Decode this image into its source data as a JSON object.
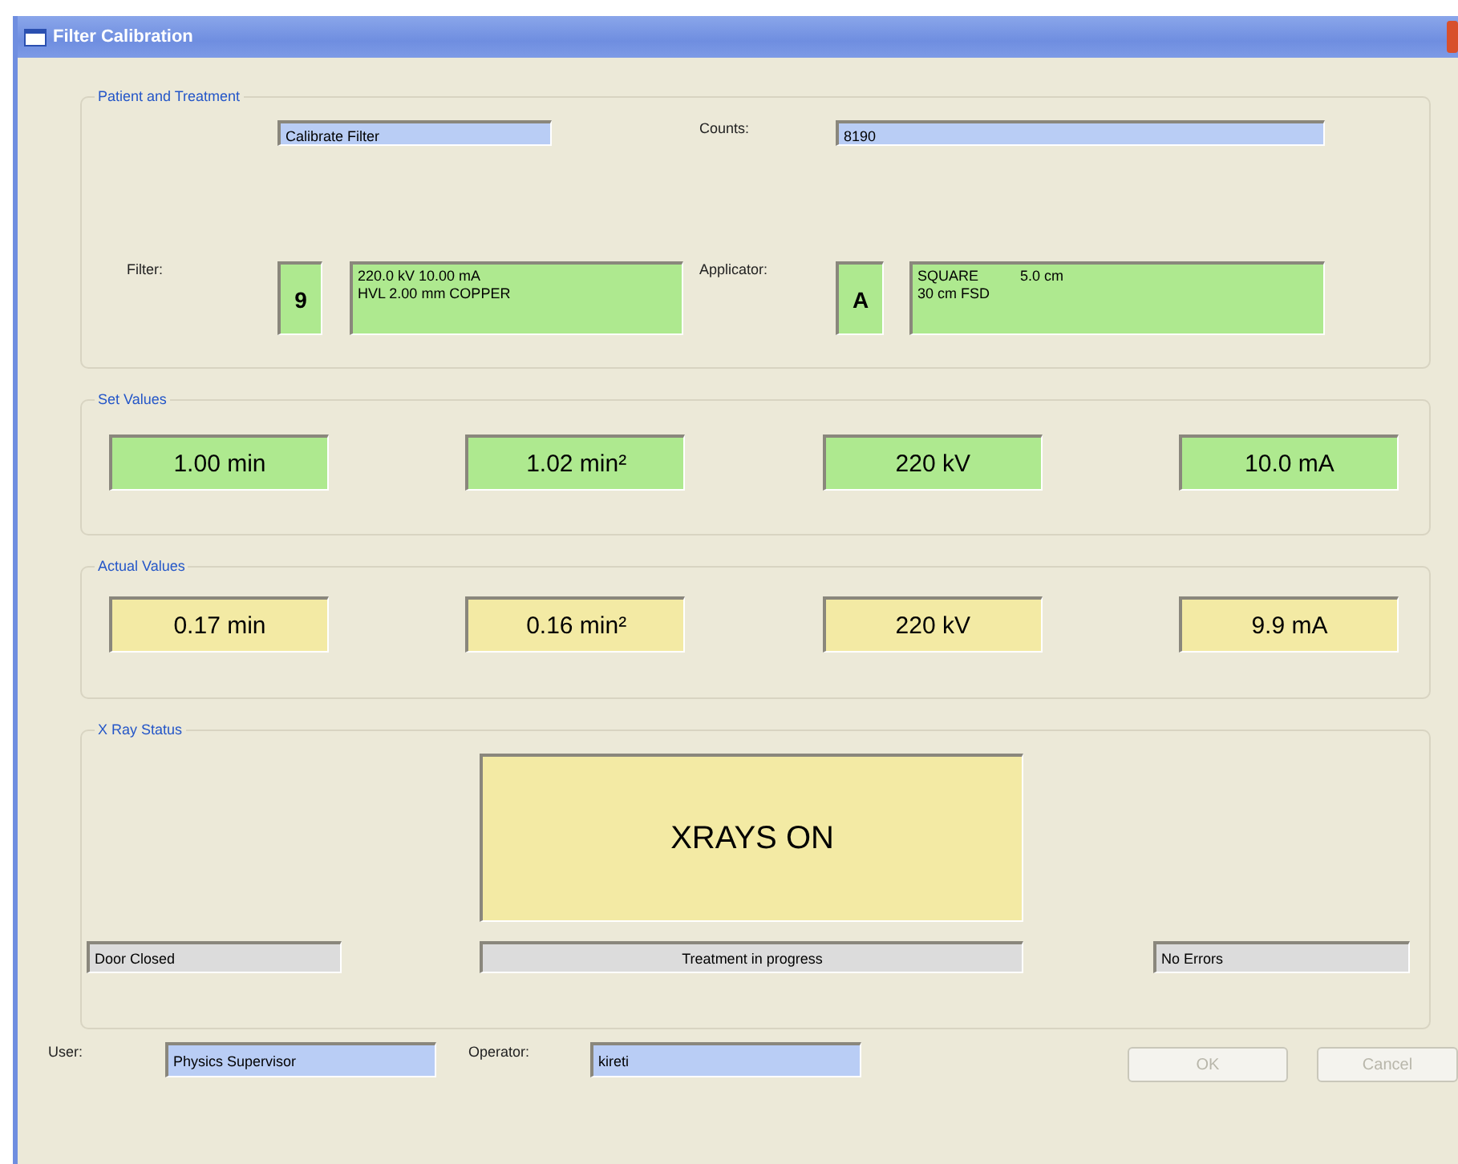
{
  "window": {
    "title": "Filter Calibration"
  },
  "patient_and_treatment": {
    "title": "Patient and Treatment",
    "mode": "Calibrate Filter",
    "counts": {
      "label": "Counts:",
      "value": "8190"
    },
    "filter": {
      "label": "Filter:",
      "code": "9",
      "lines": [
        [
          "220.0 kV 10.00 mA"
        ],
        [
          "HVL 2.00 mm COPPER"
        ]
      ]
    },
    "applicator": {
      "label": "Applicator:",
      "code": "A",
      "lines": [
        [
          "SQUARE",
          "5.0 cm"
        ],
        [
          "30 cm FSD"
        ]
      ]
    }
  },
  "set_values": {
    "title": "Set Values",
    "values": [
      "1.00 min",
      "1.02 min²",
      "220 kV",
      "10.0 mA"
    ]
  },
  "actual_values": {
    "title": "Actual Values",
    "values": [
      "0.17 min",
      "0.16 min²",
      "220 kV",
      "9.9 mA"
    ]
  },
  "xray_status": {
    "title": "X Ray Status",
    "main": "XRAYS ON",
    "door": "Door Closed",
    "treatment": "Treatment in progress",
    "errors": "No Errors"
  },
  "footer": {
    "user": {
      "label": "User:",
      "value": "Physics Supervisor"
    },
    "operator": {
      "label": "Operator:",
      "value": "kireti"
    },
    "buttons": [
      {
        "label": "OK",
        "disabled": true
      },
      {
        "label": "Cancel",
        "disabled": true
      }
    ]
  }
}
